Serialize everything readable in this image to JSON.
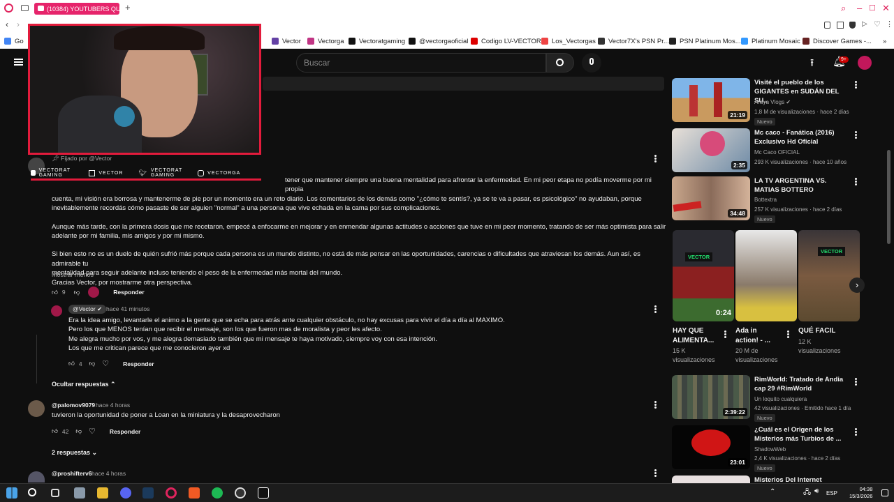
{
  "browser": {
    "tab_title": "(10384) YOUTUBERS QUE",
    "address_left": "Go",
    "bookmarks": [
      "Vector",
      "Vectorga",
      "Vectoratgaming",
      "@vectorgaoficial",
      "Codigo LV-VECTOR",
      "Los_Vectorgas",
      "Vector7X's PSN Pr...",
      "PSN Platinum Mos...",
      "Platinum Mosaic",
      "Discover Games -..."
    ]
  },
  "youtube": {
    "search_placeholder": "Buscar",
    "notif_count": "9+",
    "comments": {
      "pinned_label": "Fijado por @Vector",
      "main_text_1": "tener que mantener siempre una buena mentalidad para afrontar la enfermedad. En mi peor etapa no podía moverme por mi propia",
      "main_text_2": "cuenta, mi visión era borrosa y mantenerme de pie por un momento era un reto diario. Los comentarios de los demás como \"¿cómo te sentís?, ya se te va a pasar, es psicológico\" no ayudaban, porque",
      "main_text_3": "inevitablemente recordás cómo pasaste de ser alguien \"normal\" a una persona que vive echada en la cama por sus complicaciones.",
      "main_text_4": "Aunque más tarde, con la primera dosis que me recetaron, empecé a enfocarme en mejorar y en enmendar algunas actitudes o acciones que tuve en mi peor momento, tratando de ser más optimista para salir",
      "main_text_5": "adelante por mi familia, mis amigos y por mi mismo.",
      "main_text_6": "Si bien esto no es un duelo de quién sufrió más porque cada persona es un mundo distinto, no está de más pensar en las oportunidades, carencias o dificultades que atraviesan los demás. Aun así, es admirable tu",
      "main_text_7": "mentalidad para seguir adelante incluso teniendo el peso de la enfermedad más mortal del mundo.",
      "main_text_8": "Gracias Vector, por mostrarme otra perspectiva.",
      "show_less": "Mostrar menos",
      "main_likes": "9",
      "reply_label": "Responder",
      "reply1_author": "@Vector",
      "reply1_time": "hace 41 minutos",
      "reply1_lines": [
        "Era la idea amigo, levantarle el animo a la gente que se echa para atrás ante cualquier obstáculo, no hay excusas para vivir el día a día al MAXIMO.",
        "Pero los que MENOS tenían que recibir el mensaje, son los que fueron mas de moralista y peor les afecto.",
        "Me alegra mucho por vos, y me alegra demasiado también que mi mensaje te haya motivado, siempre voy con esa intención.",
        "Los que me critican parece que me conocieron ayer xd"
      ],
      "reply1_likes": "4",
      "hide_replies": "Ocultar respuestas",
      "c2_author": "@palomov9079",
      "c2_time": "hace 4 horas",
      "c2_text": "tuvieron la oportunidad de poner a Loan en la miniatura y la desaprovecharon",
      "c2_likes": "42",
      "c2_replies": "2 respuestas",
      "c3_author": "@proshifterv6",
      "c3_time": "hace 4 horas"
    },
    "sidebar": [
      {
        "title": "Visité el pueblo de los GIGANTES en SUDÁN DEL SU...",
        "channel": "Araya Vlogs",
        "stats": "1,8 M de visualizaciones · hace 2 días",
        "badge": "Nuevo",
        "duration": "21:19"
      },
      {
        "title": "Mc caco - Fanática (2016) Exclusivo Hd Oficial",
        "channel": "Mc Caco OFICIAL",
        "stats": "293 K visualizaciones · hace 10 años",
        "badge": "",
        "duration": "2:35"
      },
      {
        "title": "LA TV ARGENTINA VS. MATIAS BOTTERO",
        "channel": "Bottextra",
        "stats": "257 K visualizaciones · hace 2 días",
        "badge": "Nuevo",
        "duration": "34:48"
      },
      {
        "title": "RimWorld: Tratado de Andia cap 29 #RimWorld",
        "channel": "Un loquito cualquiera",
        "stats": "42 visualizaciones · Emitido hace 1 día",
        "badge": "Nuevo",
        "duration": "2:39:22"
      },
      {
        "title": "¿Cuál es el Origen de los Misterios más Turbios de ...",
        "channel": "ShadowWeb",
        "stats": "2,4 K visualizaciones · hace 2 días",
        "badge": "Nuevo",
        "duration": "23:01"
      },
      {
        "title": "Misterios Del Internet Antiguo...",
        "channel": "",
        "stats": "",
        "badge": "",
        "duration": ""
      }
    ],
    "shorts": [
      {
        "title_1": "HAY QUE",
        "title_2": "ALIMENTA...",
        "views_1": "15 K",
        "views_2": "visualizaciones",
        "badge": "VECTOR",
        "duration": "0:24"
      },
      {
        "title_1": "Ada in",
        "title_2": "action! - ...",
        "views_1": "20 M de",
        "views_2": "visualizaciones",
        "badge": "",
        "duration": ""
      },
      {
        "title_1": "QUÉ FACIL",
        "title_2": "",
        "views_1": "12 K",
        "views_2": "visualizaciones",
        "badge": "VECTOR",
        "duration": ""
      }
    ]
  },
  "overlay": {
    "socials": [
      "VECTORAT GAMING",
      "VECTOR",
      "VECTORAT GAMING",
      "VECTORGA"
    ]
  },
  "taskbar": {
    "lang": "ESP",
    "time": "04:38",
    "date": "15/3/2026"
  }
}
